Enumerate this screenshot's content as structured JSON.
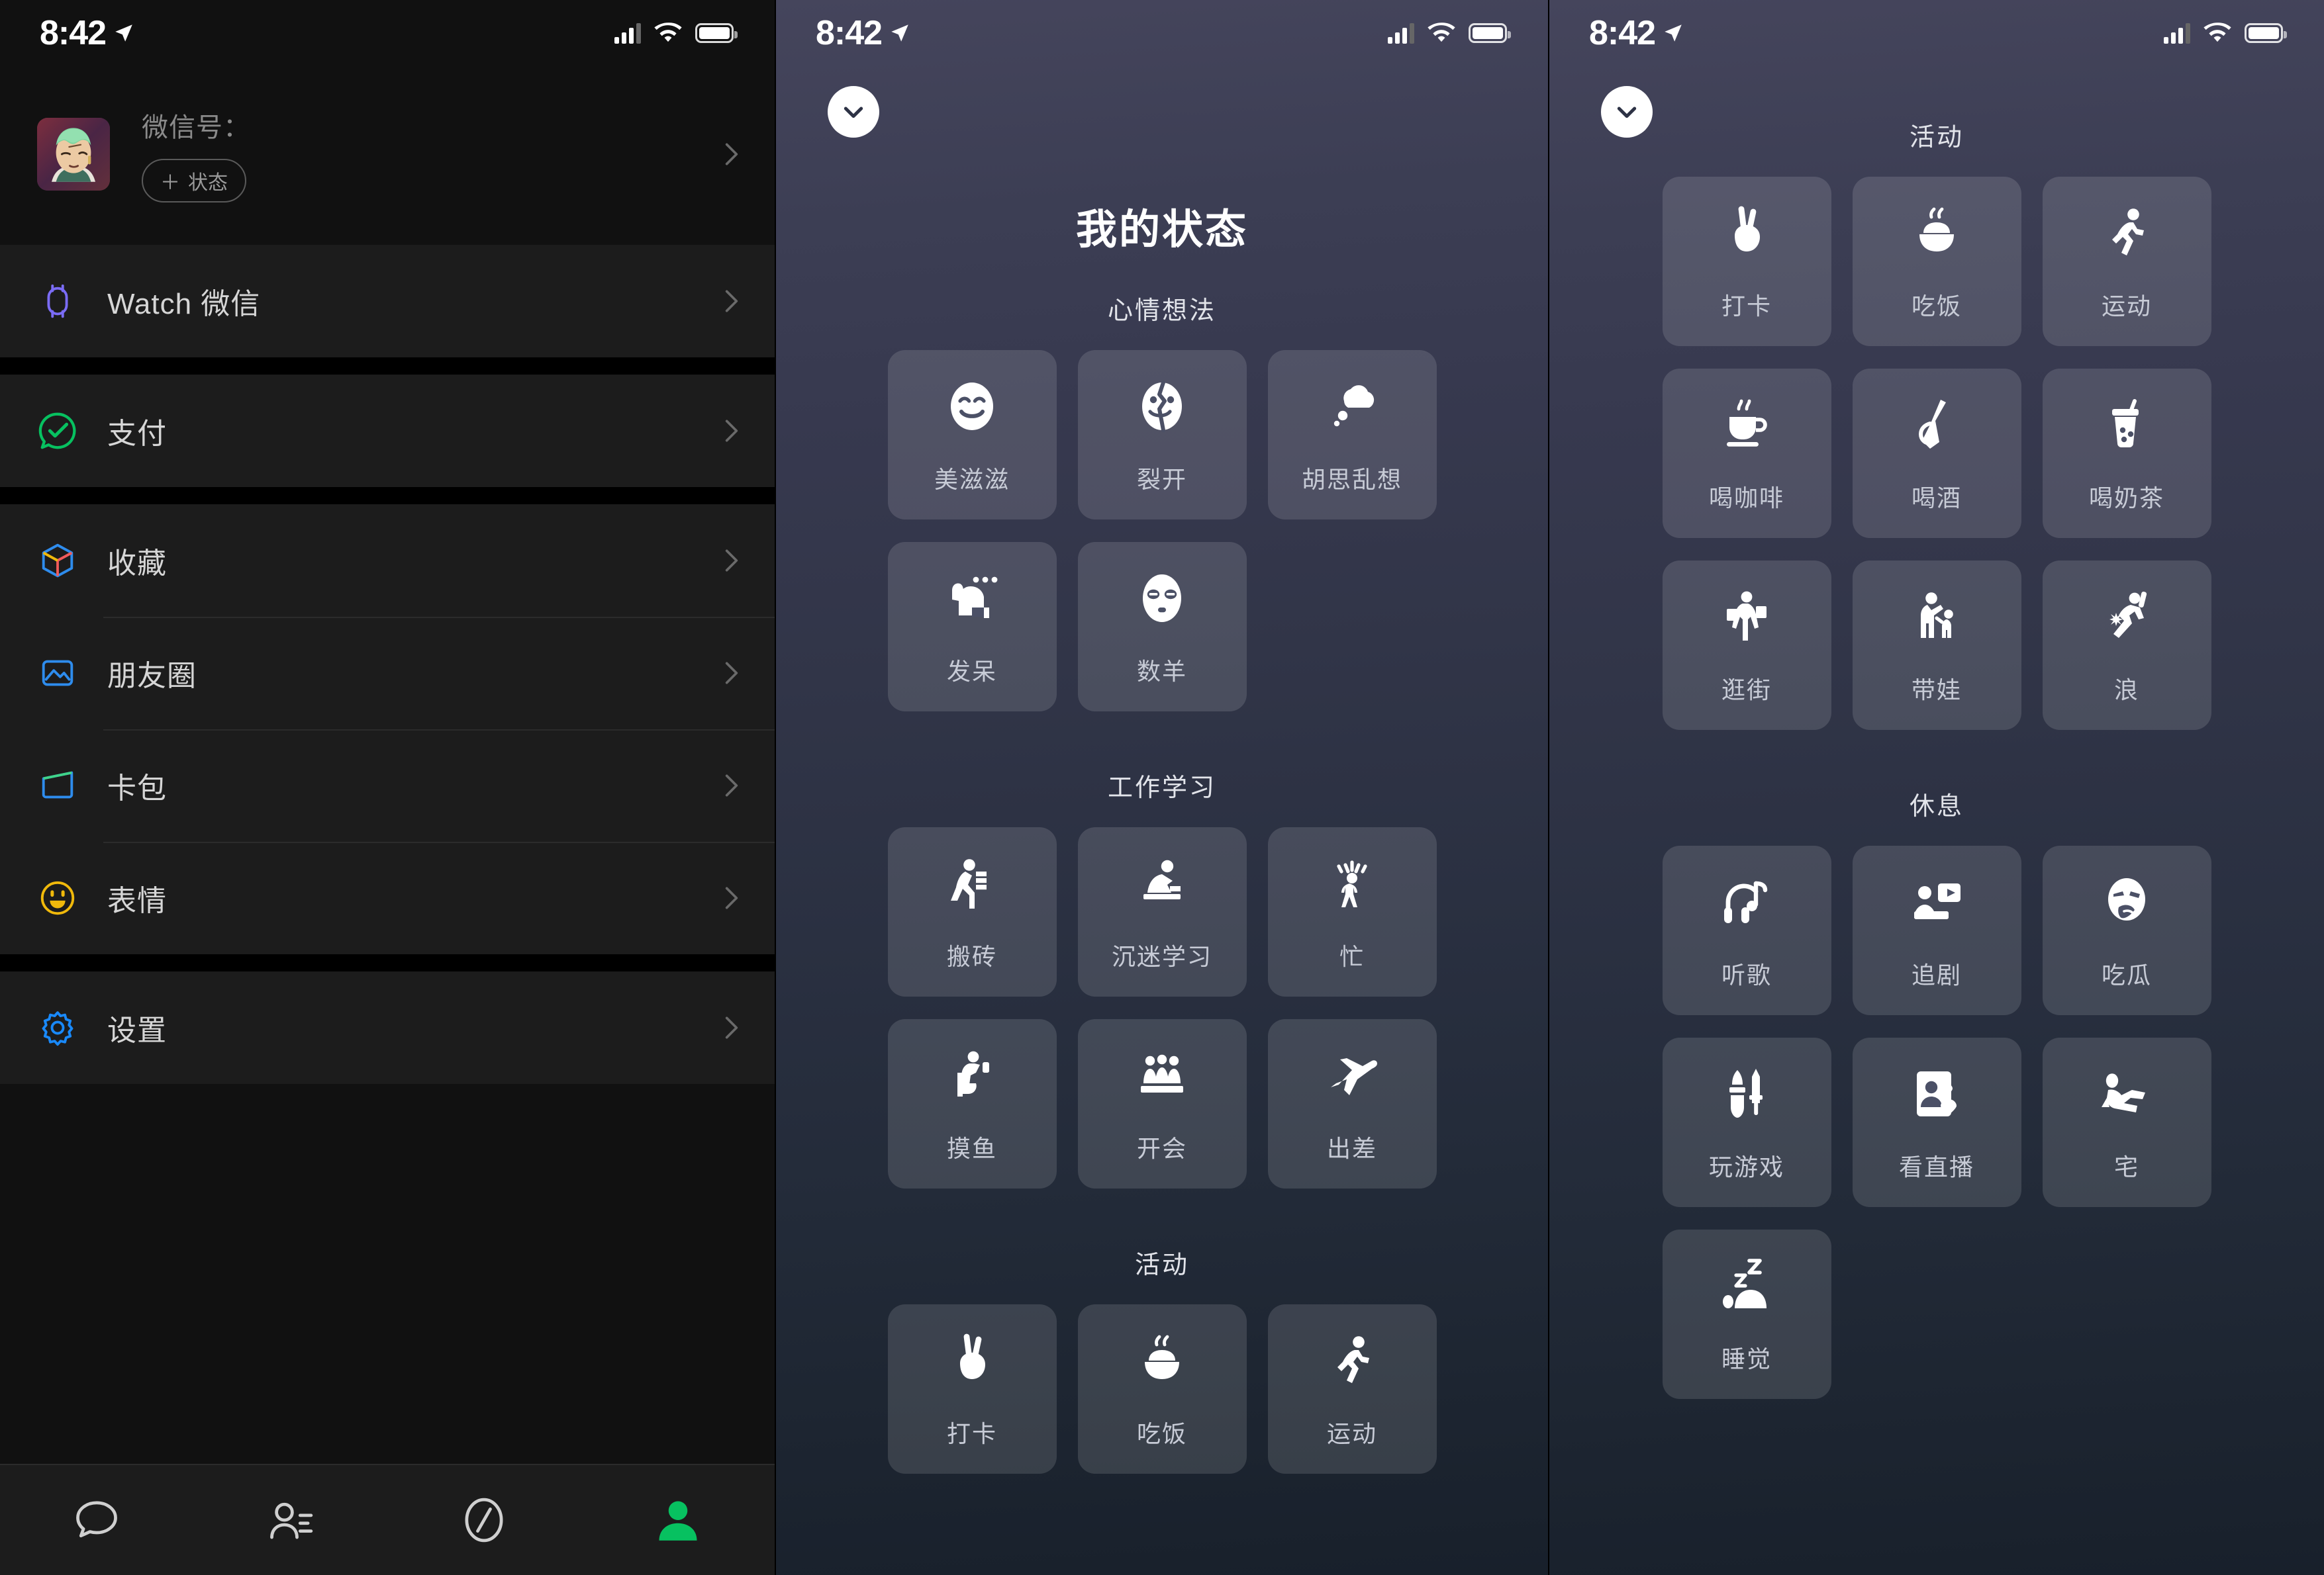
{
  "statusbar": {
    "time": "8:42",
    "location_icon": "location-arrow-icon",
    "signal_icon": "cellular-signal-icon",
    "wifi_icon": "wifi-icon",
    "battery_icon": "battery-full-icon"
  },
  "me": {
    "avatar_name": "user-avatar",
    "wxid_label": "微信号：",
    "status_chip": {
      "plus": "＋",
      "label": "状态"
    },
    "groups": [
      {
        "items": [
          {
            "label": "Watch 微信",
            "icon": "watch-icon",
            "color": "#7b6cf6"
          }
        ]
      },
      {
        "items": [
          {
            "label": "支付",
            "icon": "pay-icon",
            "color": "#07c160"
          }
        ]
      },
      {
        "items": [
          {
            "label": "收藏",
            "icon": "favorites-cube-icon",
            "color": "#2e8ced"
          },
          {
            "label": "朋友圈",
            "icon": "moments-photo-icon",
            "color": "#2e8ced"
          },
          {
            "label": "卡包",
            "icon": "cards-wallet-icon",
            "color": "#2e8ced"
          },
          {
            "label": "表情",
            "icon": "sticker-smiley-icon",
            "color": "#f0b90b"
          }
        ]
      },
      {
        "items": [
          {
            "label": "设置",
            "icon": "settings-gear-icon",
            "color": "#1989fa"
          }
        ]
      }
    ],
    "tabs": [
      {
        "name": "chats",
        "icon": "chat-bubble-icon",
        "active": false
      },
      {
        "name": "contacts",
        "icon": "contacts-icon",
        "active": false
      },
      {
        "name": "discover",
        "icon": "compass-icon",
        "active": false
      },
      {
        "name": "me",
        "icon": "person-icon",
        "active": true
      }
    ],
    "accent_color": "#07c160"
  },
  "status_screen_1": {
    "collapse_icon": "chevron-down-icon",
    "title": "我的状态",
    "sections": [
      {
        "title": "心情想法",
        "items": [
          {
            "label": "美滋滋",
            "icon": "smiling-face-icon"
          },
          {
            "label": "裂开",
            "icon": "cracked-face-icon"
          },
          {
            "label": "胡思乱想",
            "icon": "thought-cloud-icon"
          },
          {
            "label": "发呆",
            "icon": "daydream-cat-icon"
          },
          {
            "label": "数羊",
            "icon": "sleepy-face-icon"
          }
        ]
      },
      {
        "title": "工作学习",
        "items": [
          {
            "label": "搬砖",
            "icon": "carrying-bricks-icon"
          },
          {
            "label": "沉迷学习",
            "icon": "studying-desk-icon"
          },
          {
            "label": "忙",
            "icon": "busy-person-icon"
          },
          {
            "label": "摸鱼",
            "icon": "slacking-toilet-icon"
          },
          {
            "label": "开会",
            "icon": "meeting-people-icon"
          },
          {
            "label": "出差",
            "icon": "airplane-icon"
          }
        ]
      },
      {
        "title": "活动",
        "items": [
          {
            "label": "打卡",
            "icon": "peace-hand-icon"
          },
          {
            "label": "吃饭",
            "icon": "rice-bowl-icon"
          },
          {
            "label": "运动",
            "icon": "running-person-icon"
          }
        ]
      }
    ]
  },
  "status_screen_2": {
    "collapse_icon": "chevron-down-icon",
    "sections": [
      {
        "title": "活动",
        "items": [
          {
            "label": "打卡",
            "icon": "peace-hand-icon"
          },
          {
            "label": "吃饭",
            "icon": "rice-bowl-icon"
          },
          {
            "label": "运动",
            "icon": "running-person-icon"
          },
          {
            "label": "喝咖啡",
            "icon": "coffee-cup-icon"
          },
          {
            "label": "喝酒",
            "icon": "liquor-bottle-icon"
          },
          {
            "label": "喝奶茶",
            "icon": "bubble-tea-icon"
          },
          {
            "label": "逛街",
            "icon": "shopping-person-icon"
          },
          {
            "label": "带娃",
            "icon": "parent-child-icon"
          },
          {
            "label": "浪",
            "icon": "partying-person-icon"
          }
        ]
      },
      {
        "title": "休息",
        "items": [
          {
            "label": "听歌",
            "icon": "headphones-music-icon"
          },
          {
            "label": "追剧",
            "icon": "watching-tv-icon"
          },
          {
            "label": "吃瓜",
            "icon": "gossip-face-icon"
          },
          {
            "label": "玩游戏",
            "icon": "game-sword-shield-icon"
          },
          {
            "label": "看直播",
            "icon": "livestream-phone-icon"
          },
          {
            "label": "宅",
            "icon": "lying-home-icon"
          },
          {
            "label": "睡觉",
            "icon": "sleeping-zzz-icon"
          }
        ]
      }
    ]
  }
}
